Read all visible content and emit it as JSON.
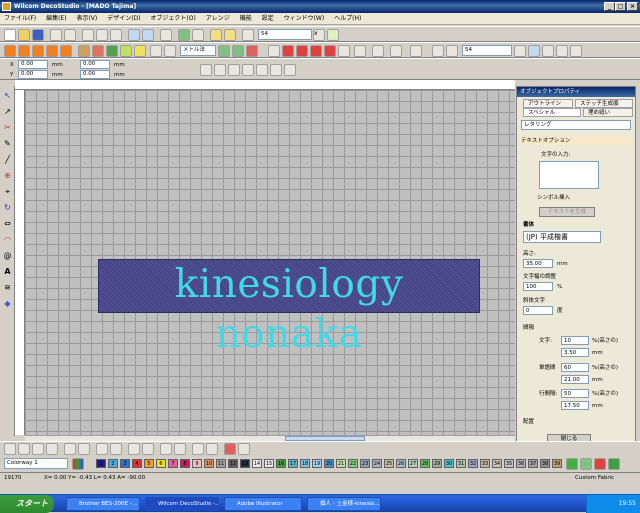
{
  "window": {
    "title": "Wilcom DecoStudio - [MADO         Tajima]"
  },
  "menu": [
    "ファイル(F)",
    "編集(E)",
    "表示(V)",
    "デザイン(D)",
    "オブジェクト(O)",
    "アレンジ",
    "機能",
    "設定",
    "ウィンドウ(W)",
    "ヘルプ(H)"
  ],
  "toolbar1": {
    "size_value": "54",
    "size_close": "x"
  },
  "toolbar2": {
    "font_select": "メトル法",
    "zoom_value": "54"
  },
  "coords": {
    "x_value": "0.00",
    "y_value": "0.00",
    "w_value": "0.00",
    "h_value": "0.00",
    "unit": "mm"
  },
  "canvas": {
    "embroidery_text": "kinesiology nonaka"
  },
  "panel": {
    "title": "オブジェクトプロパティ",
    "tabs": [
      "アウトライン",
      "ステッチ生成順",
      "スペシャル",
      "埋め縫い"
    ],
    "type_value": "レタリング",
    "section_text": "テキストオプション",
    "text_input_label": "文字の入力:",
    "symbol_label": "シンボル挿入",
    "generate_button": "テキストを生成",
    "font_heading": "書体",
    "font_value": "(JP) 平成楷書",
    "height_label": "高さ:",
    "height_value": "35.00",
    "height_unit": "mm",
    "width_label": "文字幅の調整",
    "width_value": "100",
    "width_unit": "%",
    "italic_label": "斜体文字",
    "italic_value": "0",
    "italic_unit": "度",
    "spacing_heading": "間隔",
    "char_label": "文字:",
    "char_pct": "10",
    "char_mm": "3.50",
    "word_label": "単語間",
    "word_pct": "60",
    "word_mm": "21.00",
    "line_label": "行間隔:",
    "line_pct": "50",
    "line_mm": "17.50",
    "pct_suffix": "%(高さの)",
    "mm_unit": "mm",
    "layout_heading": "配置",
    "close_button": "閉じる"
  },
  "colorbar": {
    "colorway": "Colorway 1",
    "swatches": [
      {
        "n": "1",
        "c": "#1c1c8a"
      },
      {
        "n": "2",
        "c": "#4aa8e0"
      },
      {
        "n": "3",
        "c": "#3070c8"
      },
      {
        "n": "4",
        "c": "#e03030"
      },
      {
        "n": "5",
        "c": "#f0a020"
      },
      {
        "n": "6",
        "c": "#e8e020"
      },
      {
        "n": "7",
        "c": "#e060a0"
      },
      {
        "n": "8",
        "c": "#c02060"
      },
      {
        "n": "9",
        "c": "#f0c0c0"
      },
      {
        "n": "10",
        "c": "#e09060"
      },
      {
        "n": "11",
        "c": "#a0a0a0"
      },
      {
        "n": "12",
        "c": "#606060"
      },
      {
        "n": "13",
        "c": "#203040"
      },
      {
        "n": "14",
        "c": "#f0f0f0"
      },
      {
        "n": "15",
        "c": "#e8e8e8"
      },
      {
        "n": "16",
        "c": "#40a040"
      },
      {
        "n": "17",
        "c": "#60b0d0"
      },
      {
        "n": "18",
        "c": "#80c0e0"
      },
      {
        "n": "19",
        "c": "#a0d0f0"
      },
      {
        "n": "20",
        "c": "#5090c0"
      },
      {
        "n": "21",
        "c": "#c0e0a0"
      },
      {
        "n": "22",
        "c": "#80d080"
      },
      {
        "n": "23",
        "c": "#90a0b0"
      },
      {
        "n": "24",
        "c": "#b0b0c0"
      },
      {
        "n": "25",
        "c": "#c0c0a0"
      },
      {
        "n": "26",
        "c": "#a0c0c0"
      },
      {
        "n": "27",
        "c": "#b0d0b0"
      },
      {
        "n": "28",
        "c": "#60c060"
      },
      {
        "n": "29",
        "c": "#a0b0a0"
      },
      {
        "n": "30",
        "c": "#50c0d0"
      },
      {
        "n": "31",
        "c": "#b0c0b0"
      },
      {
        "n": "32",
        "c": "#a0a0c0"
      },
      {
        "n": "33",
        "c": "#c0b0a0"
      },
      {
        "n": "34",
        "c": "#d0c0b0"
      },
      {
        "n": "35",
        "c": "#c0c0c0"
      },
      {
        "n": "36",
        "c": "#b0b0b0"
      },
      {
        "n": "37",
        "c": "#a0a0a0"
      },
      {
        "n": "38",
        "c": "#909090"
      },
      {
        "n": "39",
        "c": "#c0a070"
      }
    ]
  },
  "status": {
    "left": "19170",
    "mid": "X= 0.00 Y= -0.43 L= 0.43 A= -90.00",
    "fabric": "Custom Fabric"
  },
  "taskbar": {
    "start": "スタート",
    "tasks": [
      "Brother BES-200E -...",
      "Wilcom DecoStudio -...",
      "Adobe Illustrator",
      "個人・土金様-kinesio..."
    ],
    "clock": "19:55"
  }
}
